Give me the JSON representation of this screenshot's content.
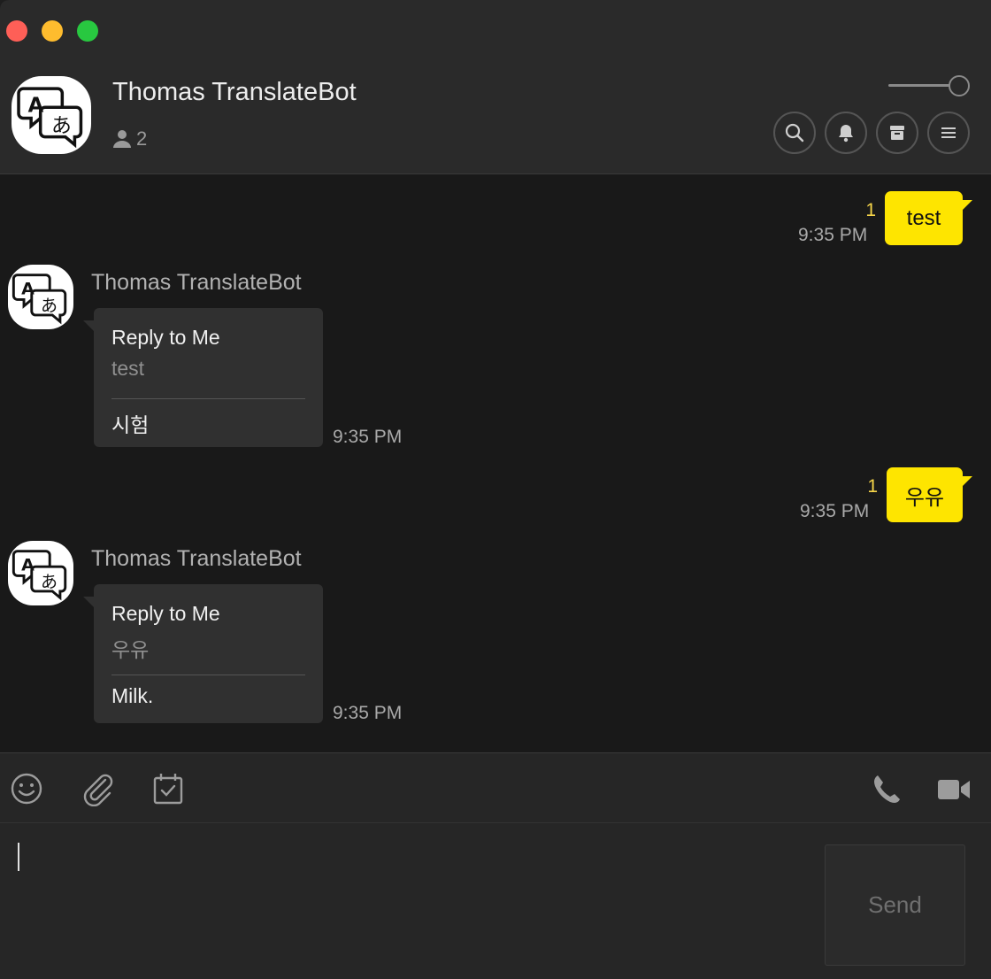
{
  "header": {
    "title": "Thomas TranslateBot",
    "member_count": "2",
    "buttons": [
      "search-icon",
      "bell-icon",
      "archive-icon",
      "menu-icon"
    ]
  },
  "messages": [
    {
      "from": "me",
      "text": "test",
      "read_count": "1",
      "time": "9:35 PM"
    },
    {
      "from": "bot",
      "sender": "Thomas TranslateBot",
      "card_title": "Reply to Me",
      "original": "test",
      "translation": "시험",
      "time": "9:35 PM"
    },
    {
      "from": "me",
      "text": "우유",
      "read_count": "1",
      "time": "9:35 PM"
    },
    {
      "from": "bot",
      "sender": "Thomas TranslateBot",
      "card_title": "Reply to Me",
      "original": "우유",
      "translation": "Milk.",
      "time": "9:35 PM"
    }
  ],
  "toolbar": {
    "left_icons": [
      "emoji-icon",
      "attachment-icon",
      "calendar-icon"
    ],
    "right_icons": [
      "phone-icon",
      "video-icon"
    ]
  },
  "composer": {
    "value": "",
    "send_label": "Send"
  },
  "colors": {
    "my_bubble": "#fee500",
    "read_count": "#f7d64a",
    "card_bg": "#303030",
    "background": "#191919"
  }
}
